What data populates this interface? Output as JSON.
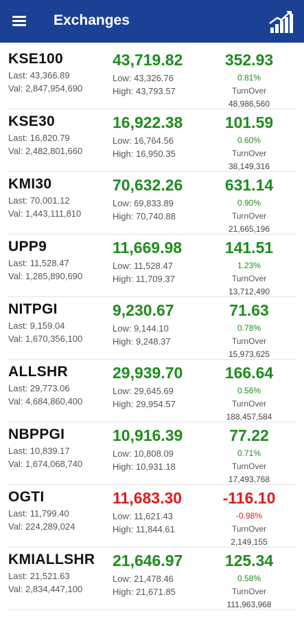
{
  "header": {
    "title": "Exchanges",
    "menu_icon": "hamburger-menu-icon",
    "chart_icon": "growth-chart-icon",
    "bg_color": "#1b4194"
  },
  "colors": {
    "positive": "#1f8c1f",
    "negative": "#e01b1b"
  },
  "labels": {
    "last_prefix": "Last: ",
    "val_prefix": "Val: ",
    "low_prefix": "Low: ",
    "high_prefix": "High: ",
    "turnover": "TurnOver"
  },
  "rows": [
    {
      "symbol": "KSE100",
      "last": "43,366.89",
      "val": "2,847,954,690",
      "price": "43,719.82",
      "low": "43,326.76",
      "high": "43,793.57",
      "change": "352.93",
      "percent": "0.81%",
      "turnover": "48,986,560",
      "negative": false
    },
    {
      "symbol": "KSE30",
      "last": "16,820.79",
      "val": "2,482,801,660",
      "price": "16,922.38",
      "low": "16,764.56",
      "high": "16,950.35",
      "change": "101.59",
      "percent": "0.60%",
      "turnover": "38,149,316",
      "negative": false
    },
    {
      "symbol": "KMI30",
      "last": "70,001.12",
      "val": "1,443,111,810",
      "price": "70,632.26",
      "low": "69,833.89",
      "high": "70,740.88",
      "change": "631.14",
      "percent": "0.90%",
      "turnover": "21,665,196",
      "negative": false
    },
    {
      "symbol": "UPP9",
      "last": "11,528.47",
      "val": "1,285,890,690",
      "price": "11,669.98",
      "low": "11,528.47",
      "high": "11,709.37",
      "change": "141.51",
      "percent": "1.23%",
      "turnover": "13,712,490",
      "negative": false
    },
    {
      "symbol": "NITPGI",
      "last": "9,159.04",
      "val": "1,670,356,100",
      "price": "9,230.67",
      "low": "9,144.10",
      "high": "9,248.37",
      "change": "71.63",
      "percent": "0.78%",
      "turnover": "15,973,625",
      "negative": false
    },
    {
      "symbol": "ALLSHR",
      "last": "29,773.06",
      "val": "4,684,860,400",
      "price": "29,939.70",
      "low": "29,645.69",
      "high": "29,954.57",
      "change": "166.64",
      "percent": "0.56%",
      "turnover": "188,457,584",
      "negative": false
    },
    {
      "symbol": "NBPPGI",
      "last": "10,839.17",
      "val": "1,674,068,740",
      "price": "10,916.39",
      "low": "10,808.09",
      "high": "10,931.18",
      "change": "77.22",
      "percent": "0.71%",
      "turnover": "17,493,768",
      "negative": false
    },
    {
      "symbol": "OGTI",
      "last": "11,799.40",
      "val": "224,289,024",
      "price": "11,683.30",
      "low": "11,621.43",
      "high": "11,844.61",
      "change": "-116.10",
      "percent": "-0.98%",
      "turnover": "2,149,155",
      "negative": true
    },
    {
      "symbol": "KMIALLSHR",
      "last": "21,521.63",
      "val": "2,834,447,100",
      "price": "21,646.97",
      "low": "21,478.46",
      "high": "21,671.85",
      "change": "125.34",
      "percent": "0.58%",
      "turnover": "111,963,968",
      "negative": false
    }
  ]
}
